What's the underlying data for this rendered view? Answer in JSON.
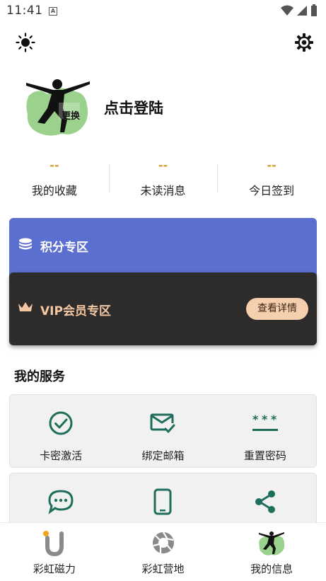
{
  "status_bar": {
    "time": "11:41",
    "indicator": "A"
  },
  "header": {
    "theme_icon": "sun-icon",
    "settings_icon": "gear-icon"
  },
  "profile": {
    "avatar_label": "更换",
    "login_text": "点击登陆"
  },
  "stats": [
    {
      "value": "--",
      "label": "我的收藏"
    },
    {
      "value": "--",
      "label": "未读消息"
    },
    {
      "value": "--",
      "label": "今日签到"
    }
  ],
  "points": {
    "title": "积分专区",
    "icon": "coins-icon"
  },
  "vip": {
    "title": "VIP会员专区",
    "button": "查看详情",
    "icon": "crown-icon"
  },
  "services": {
    "title": "我的服务",
    "items": [
      {
        "label": "卡密激活",
        "icon": "check-circle-icon"
      },
      {
        "label": "绑定邮箱",
        "icon": "mail-check-icon"
      },
      {
        "label": "重置密码",
        "icon": "password-icon"
      },
      {
        "label": "",
        "icon": "chat-icon"
      },
      {
        "label": "",
        "icon": "phone-icon"
      },
      {
        "label": "",
        "icon": "share-icon"
      }
    ]
  },
  "bottom_nav": [
    {
      "label": "彩虹磁力",
      "icon": "magnet-icon"
    },
    {
      "label": "彩虹营地",
      "icon": "aperture-icon"
    },
    {
      "label": "我的信息",
      "icon": "profile-figure-icon"
    }
  ],
  "colors": {
    "points_card": "#5a6fd0",
    "vip_card": "#2e2b2b",
    "vip_text": "#f4c7a3",
    "stat_value": "#d19a2a",
    "service_icon": "#1f6e5b"
  }
}
